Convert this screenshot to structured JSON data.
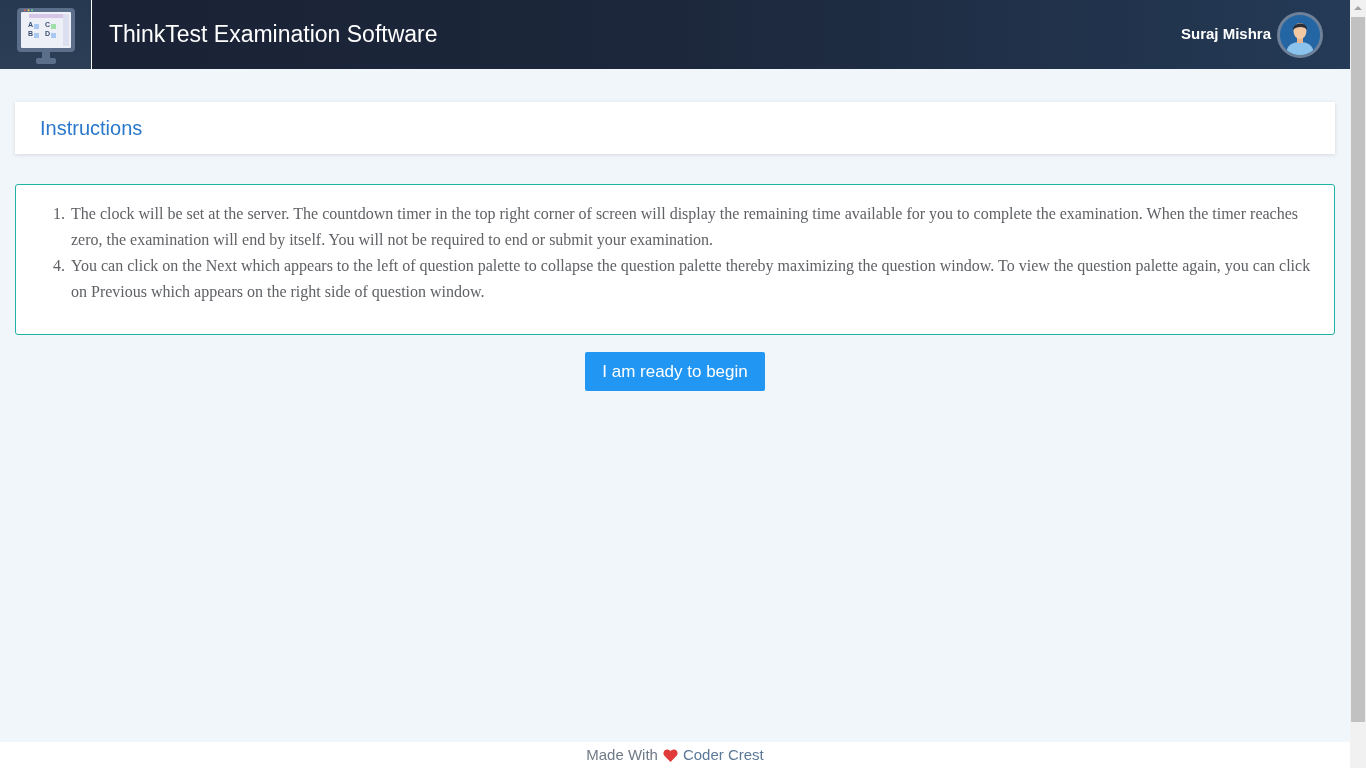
{
  "header": {
    "logo_letters": [
      "A",
      "C",
      "B",
      "D"
    ],
    "title": "ThinkTest Examination Software",
    "user_name": "Suraj Mishra"
  },
  "panel": {
    "title": "Instructions"
  },
  "instructions": [
    {
      "number": "1.",
      "text": "The clock will be set at the server. The countdown timer in the top right corner of screen will display the remaining time available for you to complete the examination. When the timer reaches zero, the examination will end by itself. You will not be required to end or submit your examination."
    },
    {
      "number": "4.",
      "text": "You can click on the Next which appears to the left of question palette to collapse the question palette thereby maximizing the question window. To view the question palette again, you can click on Previous which appears on the right side of question window."
    }
  ],
  "start_button": {
    "label": "I am ready to begin"
  },
  "footer": {
    "text": "Made With",
    "author": "Coder Crest"
  }
}
